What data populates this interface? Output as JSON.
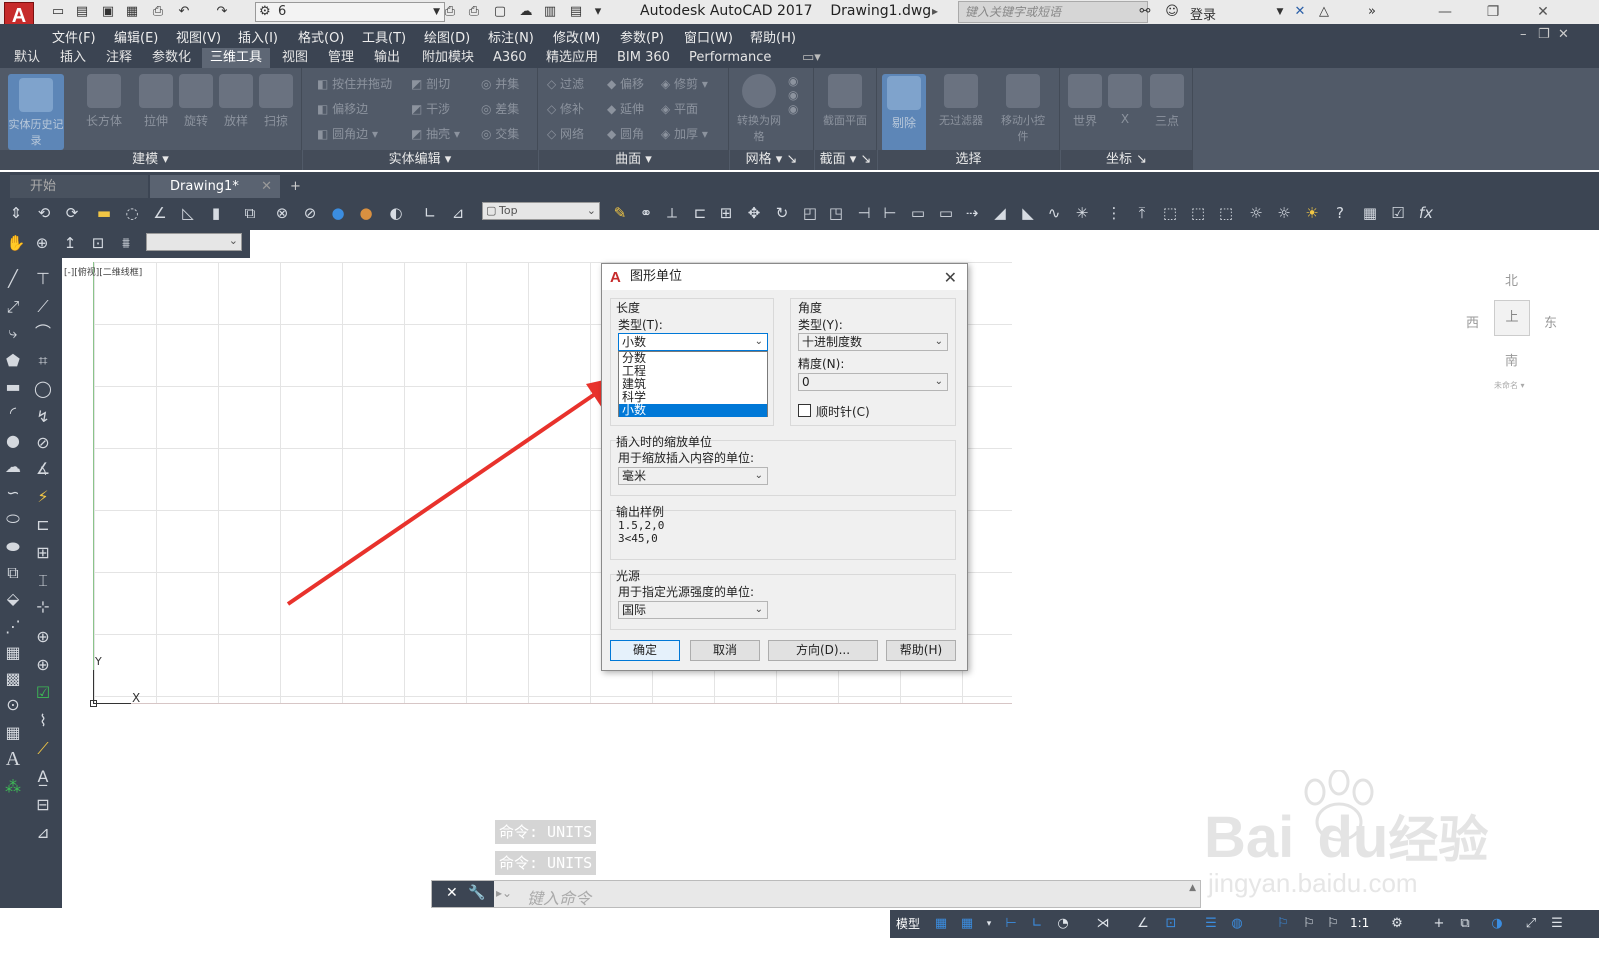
{
  "titlebar": {
    "workspace_value": "6",
    "app_title": "Autodesk AutoCAD 2017",
    "doc_title": "Drawing1.dwg",
    "search_placeholder": "键入关键字或短语",
    "login_label": "登录"
  },
  "menubar": {
    "items": [
      "文件(F)",
      "编辑(E)",
      "视图(V)",
      "插入(I)",
      "格式(O)",
      "工具(T)",
      "绘图(D)",
      "标注(N)",
      "修改(M)",
      "参数(P)",
      "窗口(W)",
      "帮助(H)"
    ]
  },
  "ribbon_tabs": {
    "items": [
      "默认",
      "插入",
      "注释",
      "参数化",
      "三维工具",
      "视图",
      "管理",
      "输出",
      "附加模块",
      "A360",
      "精选应用",
      "BIM 360",
      "Performance"
    ],
    "active": "三维工具"
  },
  "ribbon": {
    "groups": {
      "modeling": "建模",
      "solid_edit": "实体编辑",
      "surface": "曲面",
      "mesh": "网格",
      "section": "截面",
      "select": "选择",
      "coords": "坐标"
    },
    "buttons": {
      "history": "实体历史记录",
      "box": "长方体",
      "extrude": "拉伸",
      "revolve": "旋转",
      "loft": "放样",
      "sweep": "扫掠",
      "presspull": "按住并拖动",
      "slice": "剖切",
      "union": "并集",
      "offset_edge": "偏移边",
      "interfere": "干涉",
      "subtract": "差集",
      "fillet_edge": "圆角边",
      "shell": "抽壳",
      "intersect": "交集",
      "surf_trim": "过滤",
      "surf_offset": "偏移",
      "surf_fillet": "修剪",
      "surf_extend": "延伸",
      "surf_repair": "修补",
      "surf_plane": "平面",
      "surf_net": "网络",
      "surf_blend": "圆角",
      "surf_thicken": "加厚",
      "to_mesh": "转换为网格",
      "section_plane": "截面平面",
      "culling": "剔除",
      "no_filter": "无过滤器",
      "gizmo": "移动小控件",
      "world": "世界",
      "x": "X",
      "three_point": "三点"
    }
  },
  "file_tabs": {
    "start": "开始",
    "drawing": "Drawing1*"
  },
  "toolbar": {
    "view_value": "Top"
  },
  "viewport": {
    "label": "[-][俯视][二维线框]",
    "compass": {
      "north": "北",
      "south": "南",
      "east": "东",
      "west": "西",
      "top": "上",
      "wcs": "未命名"
    },
    "axis_y": "Y",
    "axis_x": "X"
  },
  "dialog": {
    "title": "图形单位",
    "length": {
      "legend": "长度",
      "type_label": "类型(T):",
      "type_value": "小数",
      "options": [
        "分数",
        "工程",
        "建筑",
        "科学",
        "小数"
      ],
      "selected_index": 4
    },
    "angle": {
      "legend": "角度",
      "type_label": "类型(Y):",
      "type_value": "十进制度数",
      "precision_label": "精度(N):",
      "precision_value": "0",
      "clockwise_label": "顺时针(C)",
      "clockwise_checked": false
    },
    "insert": {
      "legend": "插入时的缩放单位",
      "desc": "用于缩放插入内容的单位:",
      "value": "毫米"
    },
    "sample": {
      "legend": "输出样例",
      "line1": "1.5,2,0",
      "line2": "3<45,0"
    },
    "lighting": {
      "legend": "光源",
      "desc": "用于指定光源强度的单位:",
      "value": "国际"
    },
    "buttons": {
      "ok": "确定",
      "cancel": "取消",
      "direction": "方向(D)...",
      "help": "帮助(H)"
    }
  },
  "command": {
    "history": [
      "命令: UNITS",
      "命令: UNITS"
    ],
    "placeholder": "键入命令"
  },
  "statusbar": {
    "model": "模型",
    "scale": "1:1"
  },
  "watermark": {
    "brand": "Bai",
    "brand2": "du",
    "cn": "经验",
    "url": "jingyan.baidu.com"
  },
  "colors": {
    "accent": "#0078d7",
    "arrow": "#e8322c",
    "ribbon_bg": "#515a68",
    "menu_bg": "#3b4452"
  }
}
